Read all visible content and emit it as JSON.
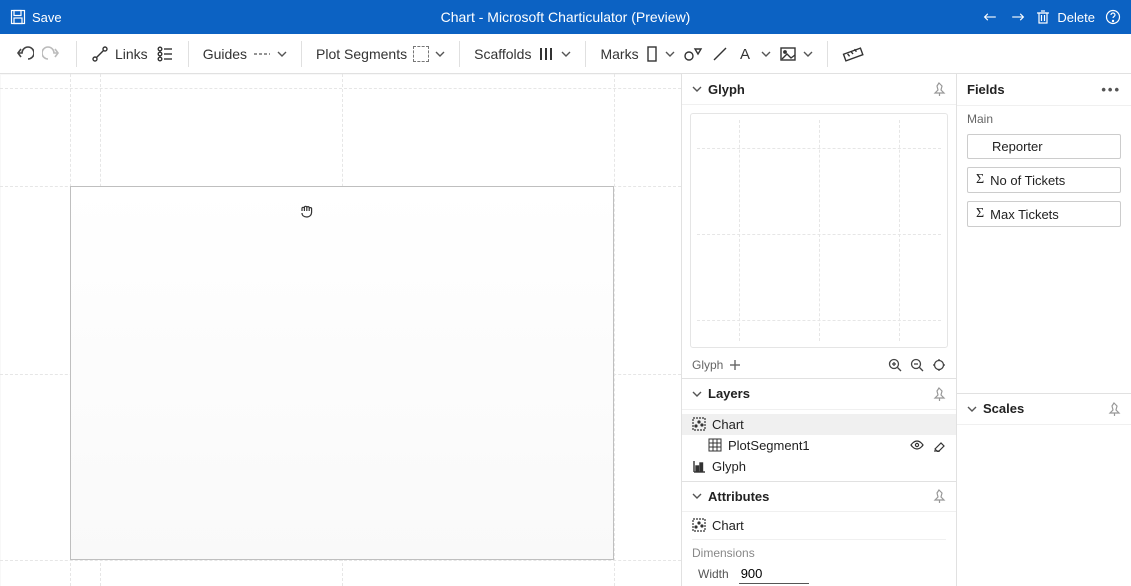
{
  "titlebar": {
    "save": "Save",
    "title": "Chart - Microsoft Charticulator (Preview)",
    "delete": "Delete"
  },
  "toolbar": {
    "links": "Links",
    "guides": "Guides",
    "plotSegments": "Plot Segments",
    "scaffolds": "Scaffolds",
    "marks": "Marks"
  },
  "panels": {
    "glyph": {
      "title": "Glyph",
      "tabLabel": "Glyph"
    },
    "layers": {
      "title": "Layers",
      "items": {
        "chart": "Chart",
        "plotSegment1": "PlotSegment1",
        "glyph": "Glyph"
      }
    },
    "attributes": {
      "title": "Attributes",
      "chart": "Chart",
      "dimensions": "Dimensions",
      "widthLabel": "Width",
      "widthValue": "900"
    },
    "fields": {
      "title": "Fields",
      "group": "Main",
      "items": {
        "reporter": "Reporter",
        "noOfTickets": "No of Tickets",
        "maxTickets": "Max Tickets"
      }
    },
    "scales": {
      "title": "Scales"
    }
  }
}
